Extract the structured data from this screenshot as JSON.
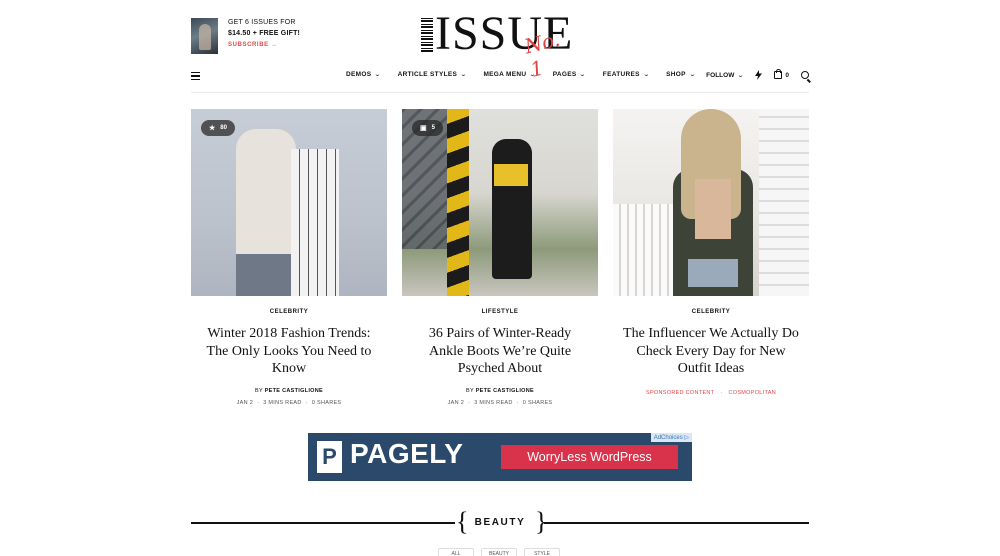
{
  "promo": {
    "line1": "GET 6 ISSUES FOR",
    "line2": "$14.50 + FREE GIFT!",
    "subscribe": "SUBSCRIBE →"
  },
  "logo": {
    "word": "ISSUE",
    "script": "No. 1"
  },
  "nav": {
    "menu": [
      {
        "label": "DEMOS"
      },
      {
        "label": "ARTICLE STYLES"
      },
      {
        "label": "MEGA MENU"
      },
      {
        "label": "PAGES"
      },
      {
        "label": "FEATURES"
      },
      {
        "label": "SHOP"
      }
    ],
    "chevron": "⌄",
    "follow": "FOLLOW",
    "cart_count": "0",
    "icons": [
      "menu-icon",
      "bolt-icon",
      "bag-icon",
      "search-icon"
    ]
  },
  "cards": [
    {
      "badge": {
        "icon": "star-icon",
        "value": "80"
      },
      "category": "CELEBRITY",
      "title": "Winter 2018 Fashion Trends: The Only Looks You Need to Know",
      "by": "BY",
      "author": "PETE CASTIGLIONE",
      "date": "JAN 2",
      "read": "3 MINS READ",
      "shares": "0 SHARES"
    },
    {
      "badge": {
        "icon": "gallery-icon",
        "value": "5"
      },
      "category": "LIFESTYLE",
      "title": "36 Pairs of Winter-Ready Ankle Boots We’re Quite Psyched About",
      "by": "BY",
      "author": "PETE CASTIGLIONE",
      "date": "JAN 2",
      "read": "3 MINS READ",
      "shares": "0 SHARES"
    },
    {
      "category": "CELEBRITY",
      "title": "The Influencer We Actually Do Check Every Day for New Outfit Ideas",
      "sponsored": "SPONSORED CONTENT",
      "sponsor": "COSMOPOLITAN"
    }
  ],
  "ad": {
    "choices": "AdChoices ▷",
    "logo_letter": "P",
    "brand": "PAGELY",
    "cta": "WorryLess WordPress",
    "colors": {
      "bg": "#2b4a6b",
      "cta": "#d8334a"
    }
  },
  "section": {
    "label": "BEAUTY",
    "brace_left": "{",
    "brace_right": "}"
  },
  "pills": [
    "ALL",
    "BEAUTY",
    "STYLE"
  ],
  "colors": {
    "accent": "#e04848",
    "text": "#111111"
  }
}
